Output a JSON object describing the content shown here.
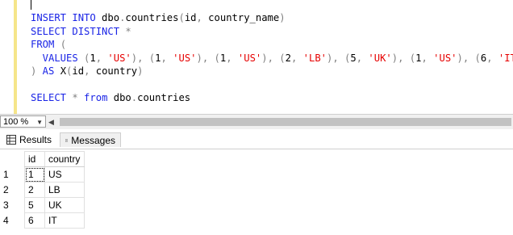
{
  "editor": {
    "lines": [
      [
        {
          "t": "INSERT INTO",
          "c": "kw"
        },
        {
          "t": " dbo",
          "c": ""
        },
        {
          "t": ".",
          "c": "gray"
        },
        {
          "t": "countries",
          "c": ""
        },
        {
          "t": "(",
          "c": "gray"
        },
        {
          "t": "id",
          "c": ""
        },
        {
          "t": ",",
          "c": "gray"
        },
        {
          "t": " country_name",
          "c": ""
        },
        {
          "t": ")",
          "c": "gray"
        }
      ],
      [
        {
          "t": "SELECT DISTINCT",
          "c": "kw"
        },
        {
          "t": " *",
          "c": "gray"
        }
      ],
      [
        {
          "t": "FROM",
          "c": "kw"
        },
        {
          "t": " (",
          "c": "gray"
        }
      ],
      [
        {
          "t": "  VALUES",
          "c": "kw"
        },
        {
          "t": " (",
          "c": "gray"
        },
        {
          "t": "1",
          "c": ""
        },
        {
          "t": ", ",
          "c": "gray"
        },
        {
          "t": "'US'",
          "c": "str"
        },
        {
          "t": "), (",
          "c": "gray"
        },
        {
          "t": "1",
          "c": ""
        },
        {
          "t": ", ",
          "c": "gray"
        },
        {
          "t": "'US'",
          "c": "str"
        },
        {
          "t": "), (",
          "c": "gray"
        },
        {
          "t": "1",
          "c": ""
        },
        {
          "t": ", ",
          "c": "gray"
        },
        {
          "t": "'US'",
          "c": "str"
        },
        {
          "t": "), (",
          "c": "gray"
        },
        {
          "t": "2",
          "c": ""
        },
        {
          "t": ", ",
          "c": "gray"
        },
        {
          "t": "'LB'",
          "c": "str"
        },
        {
          "t": "), (",
          "c": "gray"
        },
        {
          "t": "5",
          "c": ""
        },
        {
          "t": ", ",
          "c": "gray"
        },
        {
          "t": "'UK'",
          "c": "str"
        },
        {
          "t": "), (",
          "c": "gray"
        },
        {
          "t": "1",
          "c": ""
        },
        {
          "t": ", ",
          "c": "gray"
        },
        {
          "t": "'US'",
          "c": "str"
        },
        {
          "t": "), (",
          "c": "gray"
        },
        {
          "t": "6",
          "c": ""
        },
        {
          "t": ", ",
          "c": "gray"
        },
        {
          "t": "'IT'",
          "c": "str"
        },
        {
          "t": ")",
          "c": "gray"
        }
      ],
      [
        {
          "t": ")",
          "c": "gray"
        },
        {
          "t": " AS",
          "c": "kw"
        },
        {
          "t": " X",
          "c": ""
        },
        {
          "t": "(",
          "c": "gray"
        },
        {
          "t": "id",
          "c": ""
        },
        {
          "t": ",",
          "c": "gray"
        },
        {
          "t": " country",
          "c": ""
        },
        {
          "t": ")",
          "c": "gray"
        }
      ],
      [],
      [
        {
          "t": "SELECT",
          "c": "kw"
        },
        {
          "t": " *",
          "c": "gray"
        },
        {
          "t": " from",
          "c": "kw"
        },
        {
          "t": " dbo",
          "c": ""
        },
        {
          "t": ".",
          "c": "gray"
        },
        {
          "t": "countries",
          "c": ""
        }
      ]
    ]
  },
  "zoom": {
    "value": "100 %"
  },
  "tabs": {
    "results_label": "Results",
    "messages_label": "Messages"
  },
  "grid": {
    "columns": [
      "id",
      "country"
    ],
    "rows": [
      {
        "num": "1",
        "id": "1",
        "country": "US"
      },
      {
        "num": "2",
        "id": "2",
        "country": "LB"
      },
      {
        "num": "3",
        "id": "5",
        "country": "UK"
      },
      {
        "num": "4",
        "id": "6",
        "country": "IT"
      }
    ]
  },
  "colors": {
    "keyword": "#1a24e6",
    "string": "#e60000",
    "change_bar": "#f5e58a"
  }
}
